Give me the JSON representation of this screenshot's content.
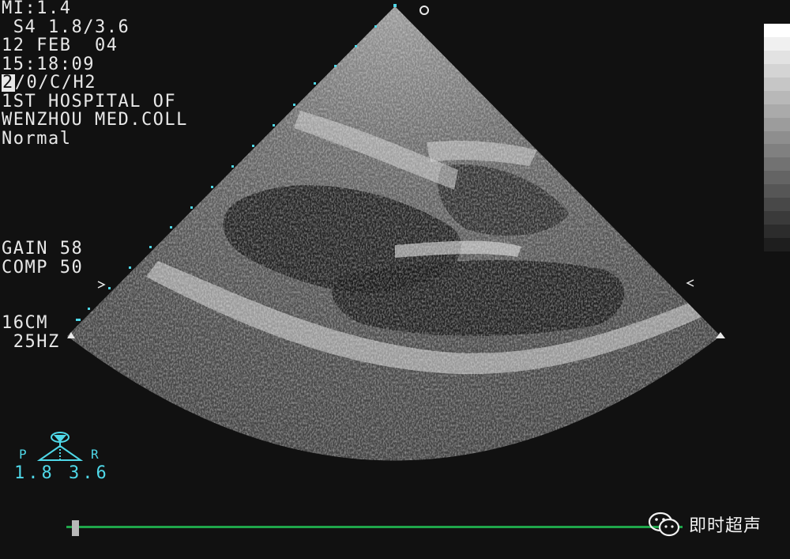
{
  "overlay": {
    "mi": "MI:1.4",
    "probe": " S4 1.8/3.6",
    "date": "12 FEB  04",
    "time": "15:18:09",
    "mode_flag": "2",
    "mode_rest": "/0/C/H2",
    "hospital_line1": "1ST HOSPITAL OF",
    "hospital_line2": "WENZHOU MED.COLL",
    "preset": "Normal",
    "gain": "GAIN 58",
    "comp": "COMP 50",
    "depth": "16CM",
    "frame_rate": " 25HZ"
  },
  "probe_indicator": {
    "left_label": "P",
    "right_label": "R",
    "frequencies": "1.8 3.6"
  },
  "watermark": {
    "icon": "wechat-icon",
    "text": "即时超声"
  },
  "colors": {
    "background": "#111111",
    "overlay_text": "#e8e8e8",
    "cyan": "#4fd8e8",
    "timeline": "#1fa64a"
  }
}
